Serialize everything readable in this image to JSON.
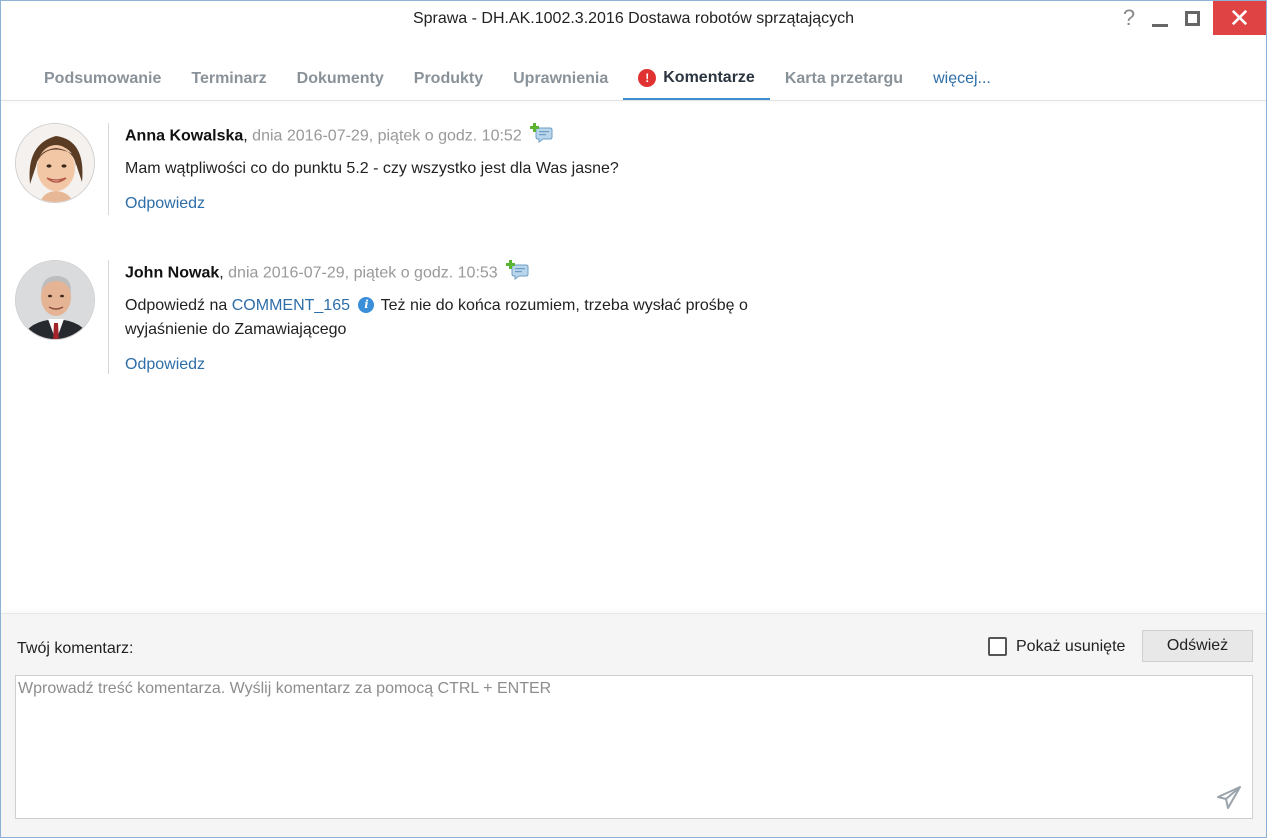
{
  "window": {
    "title": "Sprawa - DH.AK.1002.3.2016 Dostawa robotów sprzątających",
    "help_glyph": "?",
    "close_glyph": "✕"
  },
  "tabs": [
    {
      "label": "Podsumowanie"
    },
    {
      "label": "Terminarz"
    },
    {
      "label": "Dokumenty"
    },
    {
      "label": "Produkty"
    },
    {
      "label": "Uprawnienia"
    },
    {
      "label": "Komentarze",
      "active": true,
      "alert": "!"
    },
    {
      "label": "Karta przetargu"
    },
    {
      "label": "więcej..."
    }
  ],
  "comments": [
    {
      "author": "Anna Kowalska",
      "separator": ",",
      "date": "dnia 2016-07-29, piątek o godz. 10:52",
      "text": "Mam wątpliwości co do punktu 5.2 - czy wszystko jest dla Was jasne?",
      "reply_label": "Odpowiedz"
    },
    {
      "author": "John Nowak",
      "separator": ",",
      "date": "dnia 2016-07-29, piątek o godz. 10:53",
      "reply_prefix": "Odpowiedź na",
      "reply_ref": "COMMENT_165",
      "info_glyph": "i",
      "text": "Też nie do końca rozumiem, trzeba wysłać prośbę o wyjaśnienie do Zamawiającego",
      "reply_label": "Odpowiedz"
    }
  ],
  "composer": {
    "label": "Twój komentarz:",
    "show_deleted_label": "Pokaż usunięte",
    "show_deleted_checked": false,
    "refresh_label": "Odśwież",
    "placeholder": "Wprowadź treść komentarza. Wyślij komentarz za pomocą CTRL + ENTER",
    "value": ""
  },
  "colors": {
    "accent": "#3f8fd2",
    "link": "#2e6ea8",
    "alert": "#e03232",
    "close": "#e04343"
  }
}
